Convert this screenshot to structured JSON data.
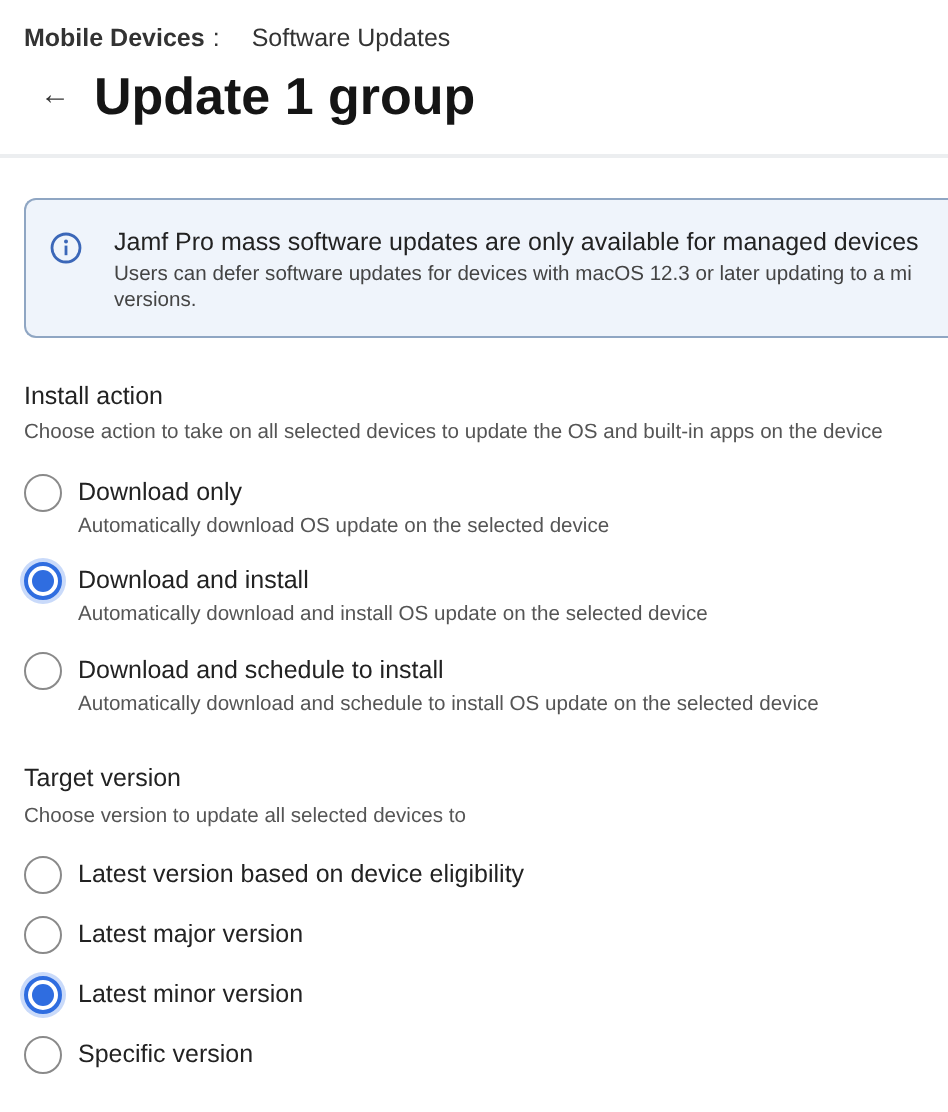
{
  "breadcrumb": {
    "parent": "Mobile Devices",
    "separator": ":",
    "current": "Software Updates"
  },
  "back_button": "←",
  "title": "Update 1 group",
  "alert": {
    "title": "Jamf Pro mass software updates are only available for managed devices",
    "lines": [
      "Users can defer software updates for devices with macOS 12.3 or later updating to a mi",
      "versions."
    ]
  },
  "sections": [
    {
      "label": "Install action",
      "hint": "Choose action to take on all selected devices to update the OS and built-in apps on the device",
      "options": [
        {
          "label": "Download only",
          "description": "Automatically download OS update on the selected device",
          "selected": false
        },
        {
          "label": "Download and install",
          "description": "Automatically download and install OS update on the selected device",
          "selected": true
        },
        {
          "label": "Download and schedule to install",
          "description": "Automatically download and schedule to install OS update on the selected device",
          "selected": false
        }
      ]
    },
    {
      "label": "Target version",
      "hint": "Choose version to update all selected devices to",
      "options": [
        {
          "label": "Latest version based on device eligibility",
          "selected": false
        },
        {
          "label": "Latest major version",
          "selected": false
        },
        {
          "label": "Latest minor version",
          "selected": true
        },
        {
          "label": "Specific version",
          "selected": false
        }
      ]
    }
  ]
}
